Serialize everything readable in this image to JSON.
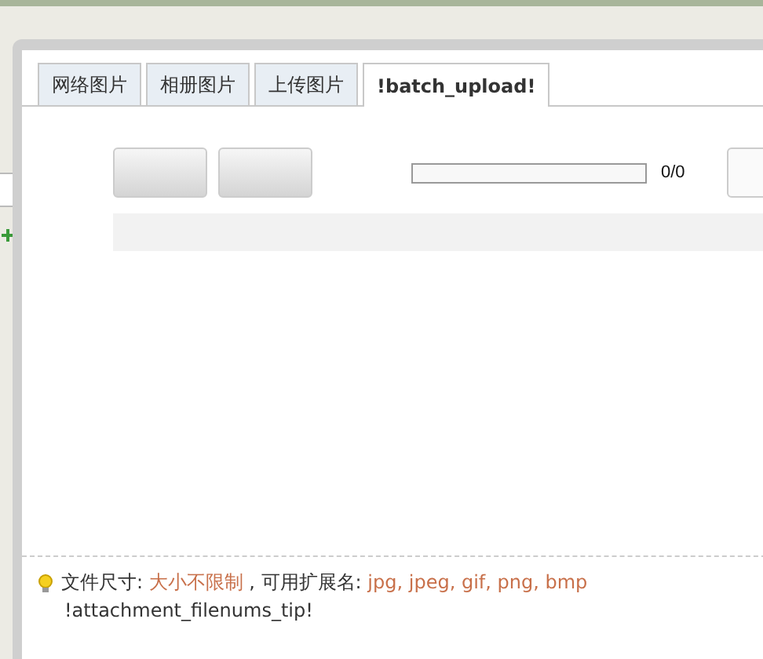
{
  "tabs": [
    {
      "label": "网络图片",
      "selected": false
    },
    {
      "label": "相册图片",
      "selected": false
    },
    {
      "label": "上传图片",
      "selected": false
    },
    {
      "label": "!batch_upload!",
      "selected": true
    }
  ],
  "upload": {
    "level": 0,
    "count": "0/0"
  },
  "tip": {
    "size_label": "文件尺寸:",
    "size_value": "大小不限制",
    "ext_label": ", 可用扩展名:",
    "ext_value": "jpg, jpeg, gif, png, bmp",
    "note": "!attachment_filenums_tip!"
  }
}
